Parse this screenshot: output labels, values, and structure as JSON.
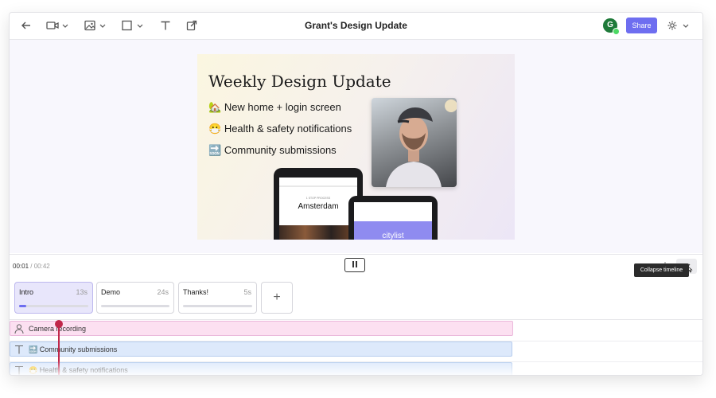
{
  "window": {
    "title": "Grant's Design Update"
  },
  "header": {
    "avatar_initial": "G",
    "share_label": "Share"
  },
  "slide": {
    "title": "Weekly Design Update",
    "bullets": [
      {
        "emoji": "🏡",
        "text": "New home + login screen"
      },
      {
        "emoji": "😷",
        "text": "Health & safety notifications"
      },
      {
        "emoji": "🔜",
        "text": "Community submissions"
      }
    ],
    "phone1": {
      "small_text": "1 STOP PROCESS",
      "city": "Amsterdam"
    },
    "phone2": {
      "app_name": "citylist"
    }
  },
  "playback": {
    "current": "00:01",
    "separator": "/",
    "total": "00:42"
  },
  "timeline": {
    "collapse_tooltip": "Collapse timeline",
    "add_scene_label": "+",
    "scenes": [
      {
        "name": "Intro",
        "duration": "13s",
        "active": true,
        "progress": 0.1
      },
      {
        "name": "Demo",
        "duration": "24s",
        "active": false,
        "progress": 0
      },
      {
        "name": "Thanks!",
        "duration": "5s",
        "active": false,
        "progress": 0
      }
    ],
    "tracks": [
      {
        "icon": "person-icon",
        "label": "Camera recording",
        "color": "#fce0f1"
      },
      {
        "icon": "text-icon",
        "label": "🔜 Community submissions",
        "color": "#dde9fb"
      },
      {
        "icon": "text-icon",
        "label": "😷 Health & safety notifications",
        "color": "#dde9fb"
      }
    ]
  },
  "colors": {
    "accent": "#6e6ef0",
    "playhead": "#c0274a",
    "online": "#4cd964"
  }
}
